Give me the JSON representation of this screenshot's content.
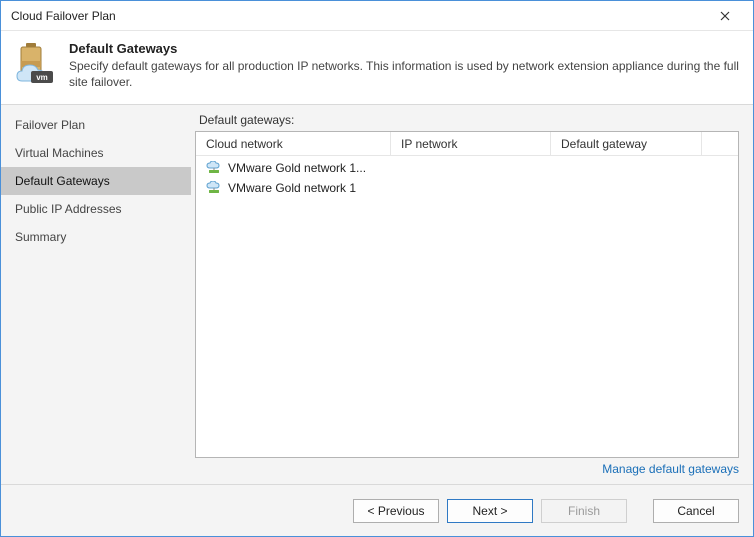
{
  "window": {
    "title": "Cloud Failover Plan"
  },
  "header": {
    "title": "Default Gateways",
    "subtitle": "Specify default gateways for all production IP networks. This information is used by network extension appliance during the full site failover."
  },
  "sidebar": {
    "items": [
      {
        "label": "Failover Plan"
      },
      {
        "label": "Virtual Machines"
      },
      {
        "label": "Default Gateways"
      },
      {
        "label": "Public IP Addresses"
      },
      {
        "label": "Summary"
      }
    ],
    "active_index": 2
  },
  "main": {
    "section_label": "Default gateways:",
    "columns": {
      "cloud": "Cloud network",
      "ip": "IP network",
      "gw": "Default gateway"
    },
    "rows": [
      {
        "cloud": "VMware Gold network 1...",
        "ip": "",
        "gw": ""
      },
      {
        "cloud": "VMware Gold network 1",
        "ip": "",
        "gw": ""
      }
    ],
    "manage_link": "Manage default gateways"
  },
  "footer": {
    "previous": "< Previous",
    "next": "Next >",
    "finish": "Finish",
    "cancel": "Cancel"
  }
}
